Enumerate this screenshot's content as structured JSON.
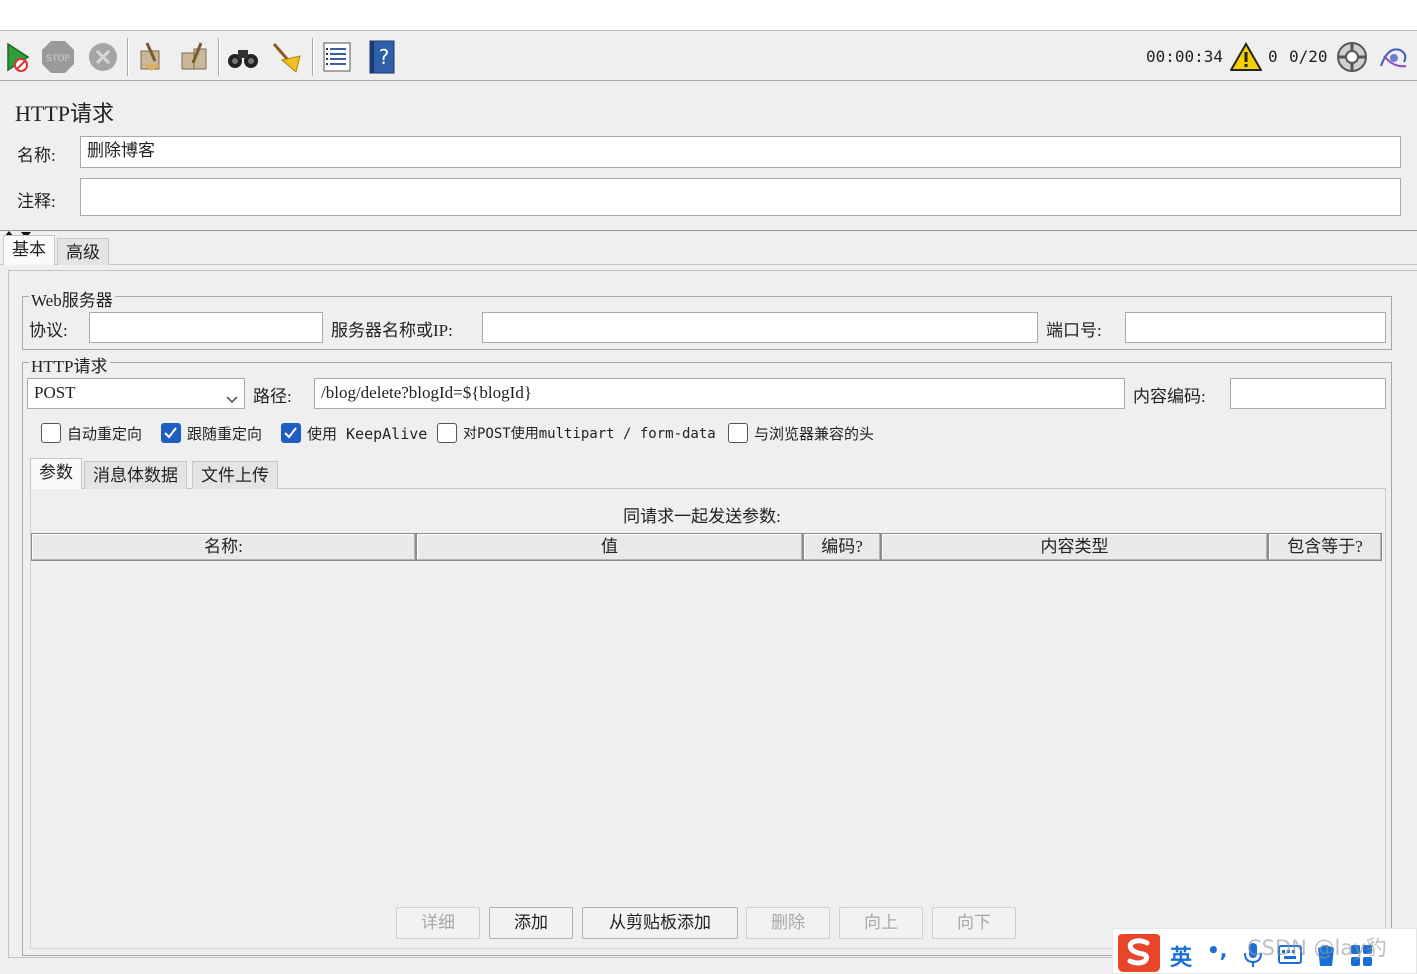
{
  "toolbar": {
    "icons": [
      "start-icon",
      "stop-icon",
      "shutdown-icon",
      "clear-icon",
      "clear-all-icon",
      "search-icon",
      "reset-search-icon",
      "function-helper-icon",
      "help-icon"
    ],
    "timer": "00:00:34",
    "warning_count": "0",
    "threads": "0/20"
  },
  "panel": {
    "title": "HTTP请求",
    "name_label": "名称:",
    "name_value": "删除博客",
    "comment_label": "注释:",
    "comment_value": ""
  },
  "outer_tabs": [
    "基本",
    "高级"
  ],
  "web_server": {
    "title": "Web服务器",
    "protocol_label": "协议:",
    "protocol_value": "",
    "server_label": "服务器名称或IP:",
    "server_value": "",
    "port_label": "端口号:",
    "port_value": ""
  },
  "http_request": {
    "title": "HTTP请求",
    "method": "POST",
    "path_label": "路径:",
    "path_value": "/blog/delete?blogId=${blogId}",
    "encoding_label": "内容编码:",
    "encoding_value": ""
  },
  "options": [
    {
      "label": "自动重定向",
      "checked": false
    },
    {
      "label": "跟随重定向",
      "checked": true
    },
    {
      "label": "使用 KeepAlive",
      "checked": true
    },
    {
      "label": "对POST使用multipart / form-data",
      "checked": false
    },
    {
      "label": "与浏览器兼容的头",
      "checked": false
    }
  ],
  "inner_tabs": [
    "参数",
    "消息体数据",
    "文件上传"
  ],
  "params": {
    "caption": "同请求一起发送参数:",
    "columns": [
      "名称:",
      "值",
      "编码?",
      "内容类型",
      "包含等于?"
    ]
  },
  "buttons": [
    {
      "label": "详细",
      "enabled": false
    },
    {
      "label": "添加",
      "enabled": true
    },
    {
      "label": "从剪贴板添加",
      "enabled": true
    },
    {
      "label": "删除",
      "enabled": false
    },
    {
      "label": "向上",
      "enabled": false
    },
    {
      "label": "向下",
      "enabled": false
    }
  ],
  "ime": {
    "lang": "英",
    "punct": "•,",
    "watermark": "CSDN @lay豹"
  },
  "colors": {
    "check_accent": "#1f5ec0",
    "ime_brand": "#e8462a",
    "ime_blue": "#1a6fd6"
  }
}
